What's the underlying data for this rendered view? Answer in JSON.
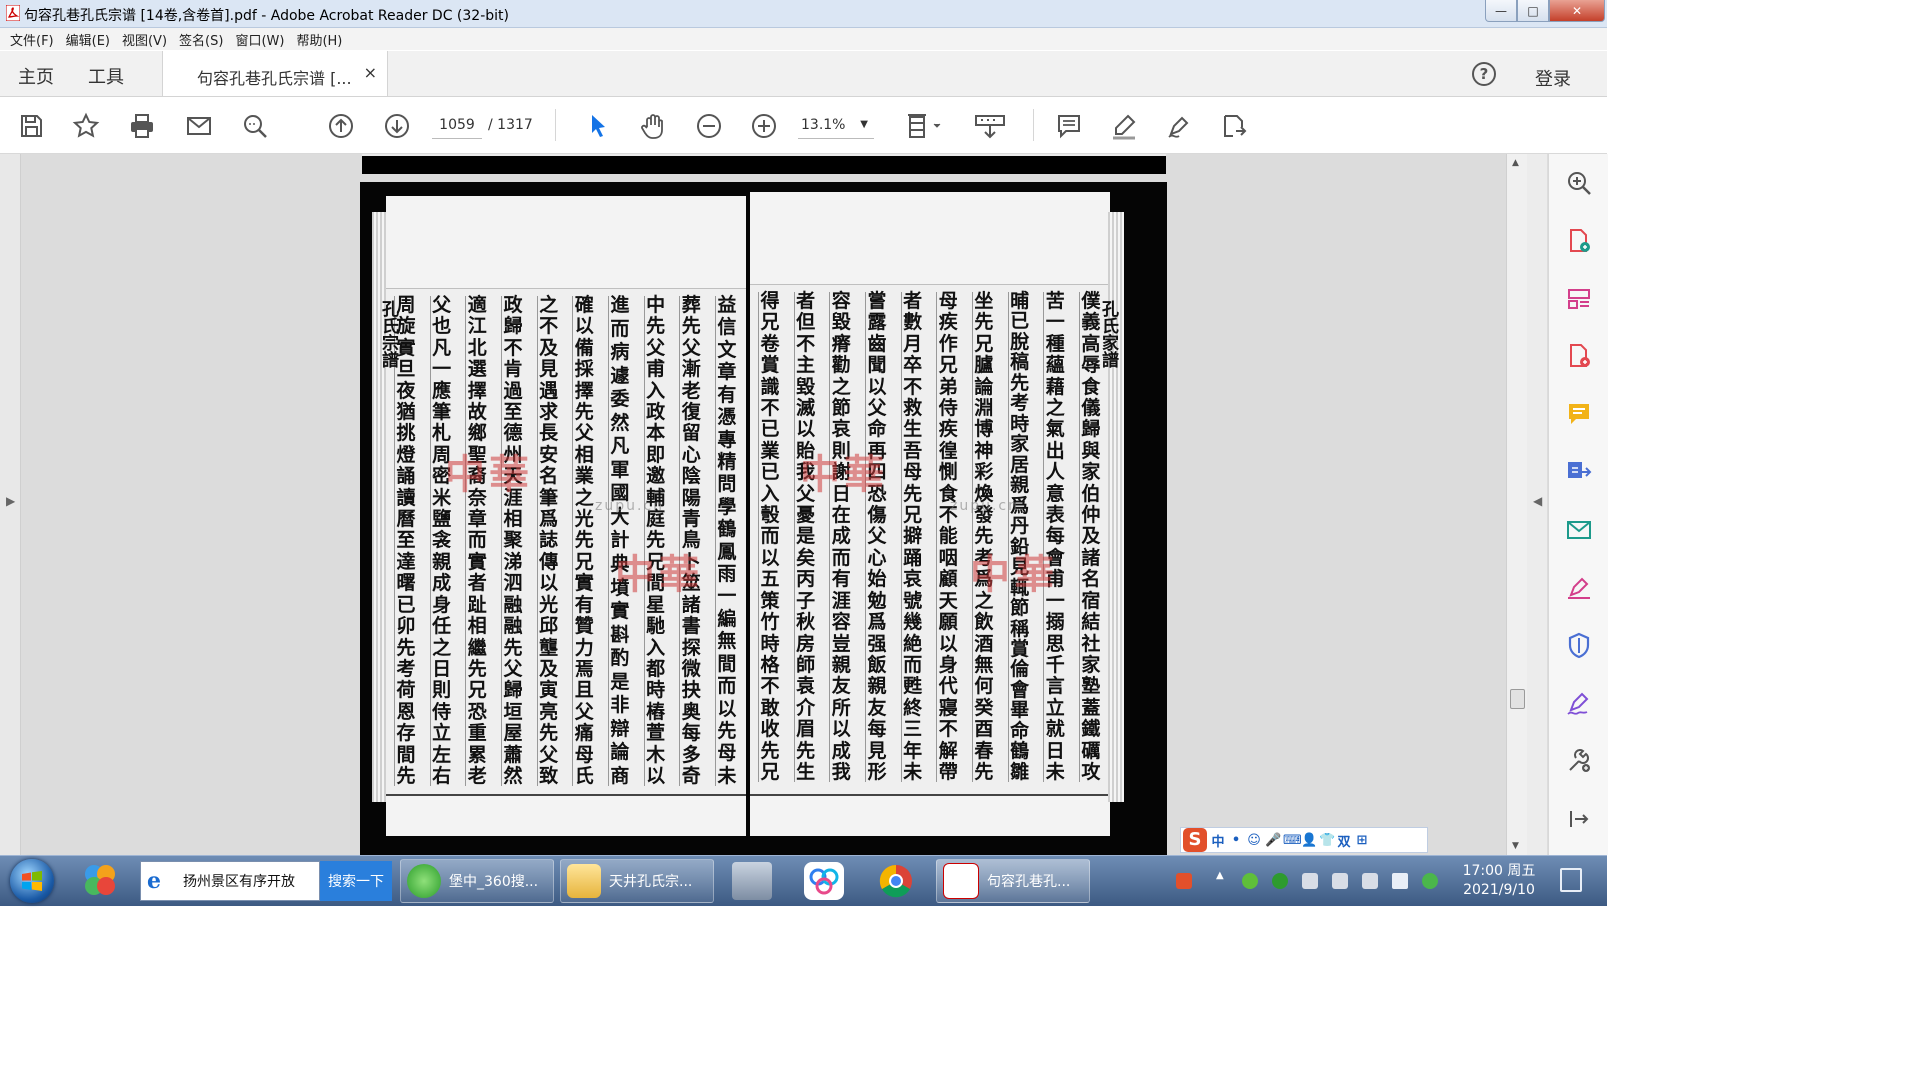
{
  "window": {
    "title": "句容孔巷孔氏宗谱 [14卷,含卷首].pdf - Adobe Acrobat Reader DC (32-bit)",
    "buttons": {
      "minimize": "—",
      "restore": "□",
      "close": "✕"
    }
  },
  "menubar": {
    "items": [
      "文件(F)",
      "编辑(E)",
      "视图(V)",
      "签名(S)",
      "窗口(W)",
      "帮助(H)"
    ]
  },
  "tabs": {
    "home": "主页",
    "tools": "工具",
    "document": "句容孔巷孔氏宗谱 [...",
    "close": "×",
    "help": "?",
    "signin": "登录"
  },
  "toolbar": {
    "page_current": "1059",
    "page_total": "/ 1317",
    "zoom": "13.1%",
    "zoom_caret": "▼",
    "icons": [
      "save-icon",
      "bookmark-star-icon",
      "print-icon",
      "email-icon",
      "find-icon",
      "prev-page-icon",
      "next-page-icon",
      "select-cursor-icon",
      "hand-icon",
      "zoom-out-icon",
      "zoom-in-icon",
      "page-fit-icon",
      "scroll-mode-icon",
      "comment-icon",
      "highlight-pen-icon",
      "fill-sign-icon",
      "export-icon"
    ]
  },
  "document": {
    "columns_right": [
      "僕義高辱食儀歸與家伯仲及諸名宿結社家塾蓋鐵礪攻",
      "苦一種蘊藉之氣出人意表每會甫一搦思千言立就日未",
      "晡已脫稿先考時家居親爲丹鉛見輒節稱賞倫會畢命鶴雛",
      "坐先兄臚論淵博神彩煥發先考爲之飲酒無何癸酉春先",
      "母疾作兄弟侍疾徨惻食不能咽顧天願以身代寢不解帶",
      "者數月卒不救生吾母先兄擗踊哀號幾絶而甦終三年未",
      "嘗露齒聞以父命再四恐傷父心始勉爲强飯親友每見形",
      "容毀瘠勸之節哀則謝日在成而有涯容豈親友所以成我",
      "者但不主毀滅以貽我父憂是矣丙子秋房師袁介眉先生",
      "得兄卷賞識不已業已入彀而以五策竹時格不敢收先兄"
    ],
    "columns_left": [
      "益信文章有憑專精問學鶴鳳雨一編無間而以先母未",
      "葬先父漸老復留心陰陽青鳥卜筮諸書探微抉奥每多奇",
      "中先父甫入政本即邀輔庭先兄間星馳入都時樁萱木以",
      "進而病遽委然凡軍國大計典墳實斟酌是非辯論商",
      "確以備採擇先父相業之光先兄實有贊力焉且父痛母氏",
      "之不及見遇求長安名筆爲誌傳以光邱壟及寅亮先父致",
      "政歸不肯過至德州天涯相聚涕泗融融先父歸垣屋蕭然",
      "適江北選擇故鄉聖裔奈章而實者趾相繼先兄恐重累老",
      "父也凡一應筆札周密米鹽衾親成身任之日則侍立左右",
      "周旋實旦夜猶挑燈誦讀曆至達曙已卯先考荷恩存間先"
    ],
    "margin_right": "孔氏家譜",
    "margin_left": "孔氏宗譜",
    "watermark": "中華",
    "watermark_sub": "zupu.cn"
  },
  "ime": {
    "logo": "S",
    "items": [
      "中",
      "•",
      "☺",
      "🎤",
      "⌨",
      "👤",
      "👕",
      "双",
      "⊞"
    ]
  },
  "taskbar": {
    "search_text": "扬州景区有序开放",
    "search_button": "搜索一下",
    "items": [
      "堡中_360搜...",
      "天井孔氏宗...",
      "句容孔巷孔..."
    ],
    "clock_time": "17:00 周五",
    "clock_date": "2021/9/10"
  },
  "colors": {
    "accent": "#1473e6",
    "taskbar": "#3d5a83",
    "close": "#c4402b",
    "watermark": "#cd3c3c"
  }
}
